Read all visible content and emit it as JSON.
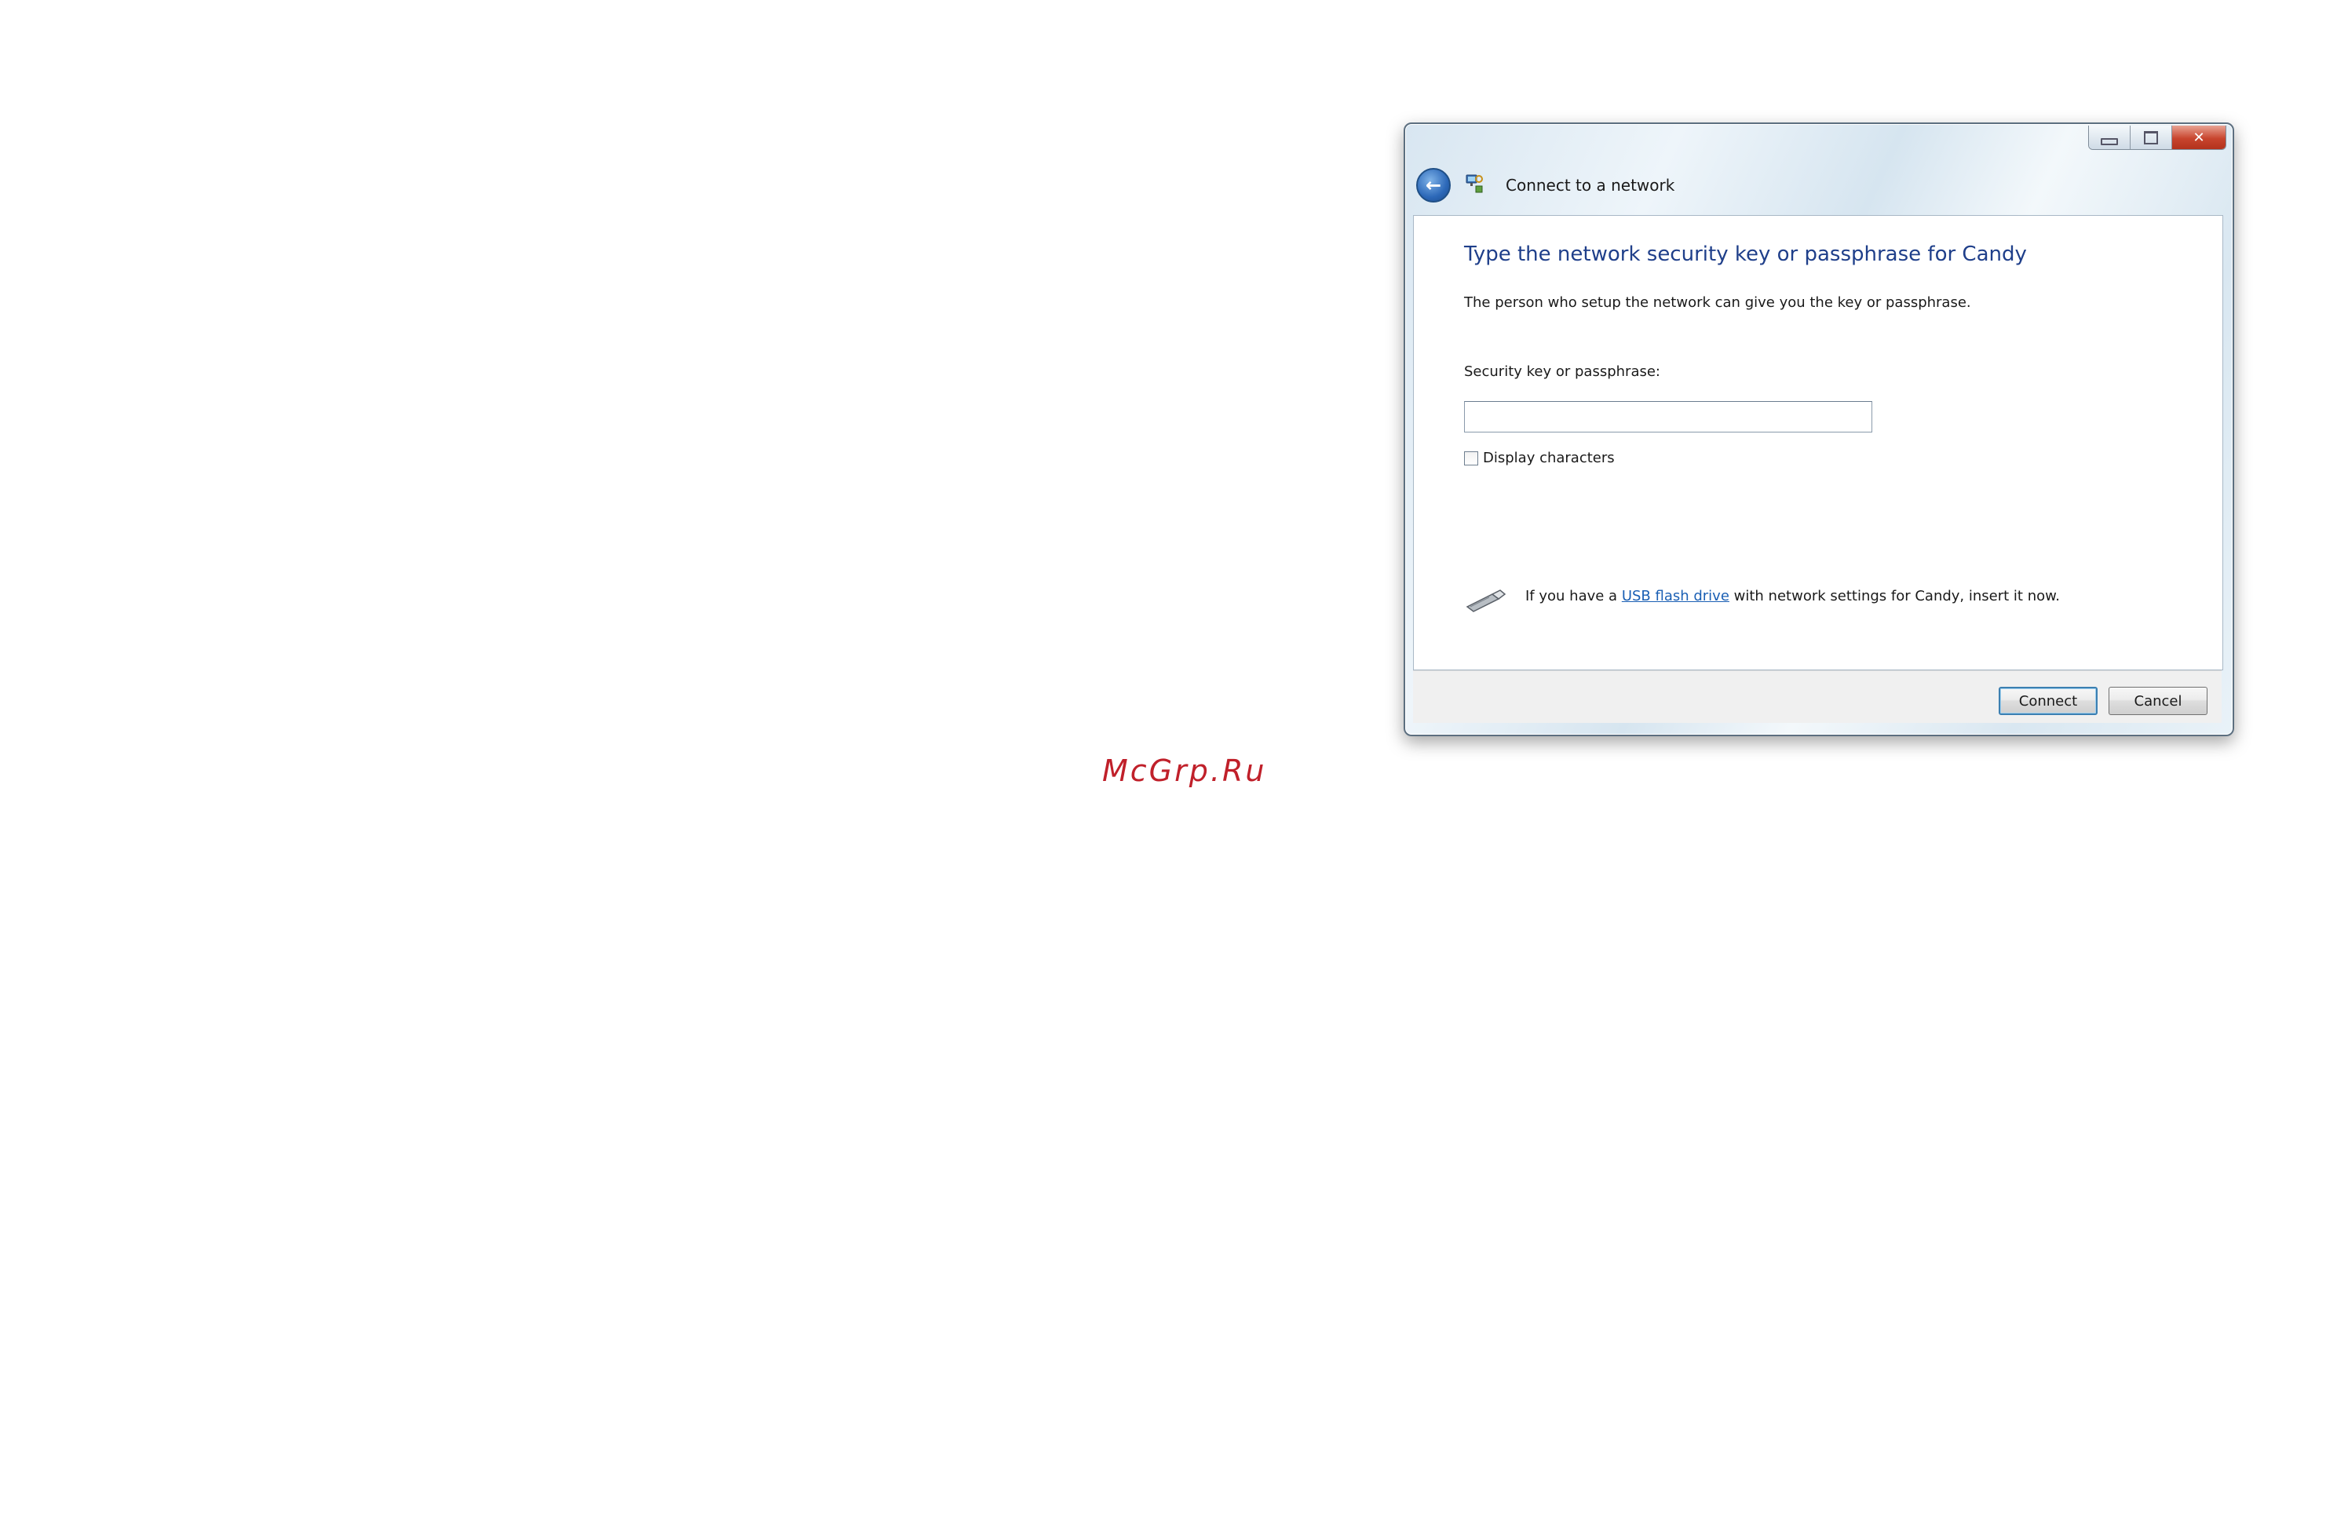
{
  "watermark": "McGrp.Ru",
  "window": {
    "title": "Connect to a network",
    "controls": {
      "minimize": "minimize",
      "maximize": "maximize",
      "close": "✕"
    },
    "back_icon": "back-arrow-icon",
    "network_icon": "network-icon"
  },
  "content": {
    "heading": "Type the network security key or passphrase for Candy",
    "description": "The person who setup the network can give you the key or passphrase.",
    "key_label": "Security key or passphrase:",
    "key_value": "",
    "display_characters_label": "Display characters",
    "display_characters_checked": false,
    "usb_prefix": "If you have a ",
    "usb_link": "USB flash drive",
    "usb_suffix": " with network settings for Candy, insert it now.",
    "usb_icon": "usb-drive-icon"
  },
  "footer": {
    "connect_label": "Connect",
    "cancel_label": "Cancel"
  },
  "colors": {
    "heading": "#1f3f8a",
    "link": "#1a5fb4",
    "watermark": "#c0202a",
    "close_button": "#c8452e"
  }
}
